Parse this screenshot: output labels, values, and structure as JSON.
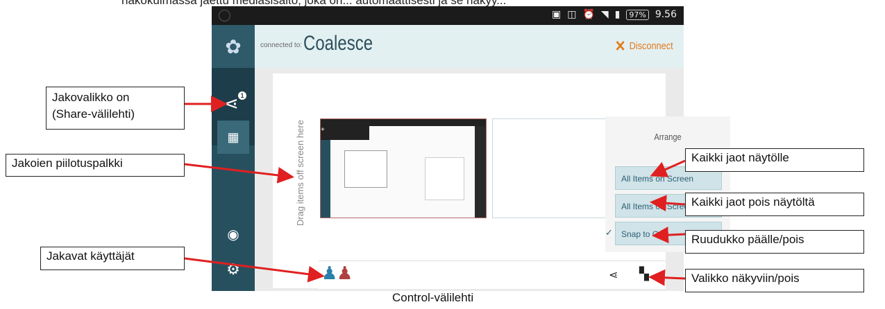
{
  "top_caption": "näkökulmassa jaettu mediasisältö, joka on... automaattisesti ja se näkyy...",
  "status_bar": {
    "battery": "97%",
    "time": "9.56"
  },
  "header": {
    "connected_label": "connected to:",
    "device_name": "Coalesce",
    "disconnect_label": "Disconnect"
  },
  "hide_bar_text": "Drag items off screen here",
  "thumbnail": {
    "dark_label": "+"
  },
  "arrange_menu": {
    "title": "Arrange",
    "items": [
      "All Items on Screen",
      "All Items off Screen",
      "Snap to Grid"
    ],
    "snap_checked": true
  },
  "callouts": {
    "share_tab": "Jakovalikko on\n(Share-välilehti)",
    "hide_bar": "Jakoien piilotuspalkki",
    "users": "Jakavat käyttäjät",
    "all_on": "Kaikki jaot näytölle",
    "all_off": "Kaikki jaot pois näytöltä",
    "grid": "Ruudukko päälle/pois",
    "menu_toggle": "Valikko näkyviin/pois"
  },
  "bottom_caption": "Control-välilehti",
  "icons": [
    "logo-icon",
    "share-icon",
    "grid-icon",
    "eye-icon",
    "gear-icon",
    "close-icon",
    "user-icon",
    "menu-toggle-icon"
  ],
  "colors": {
    "sidebar": "#27505f",
    "header": "#e3f0f2",
    "disconnect": "#e17b1a",
    "arrow": "#e02020"
  }
}
